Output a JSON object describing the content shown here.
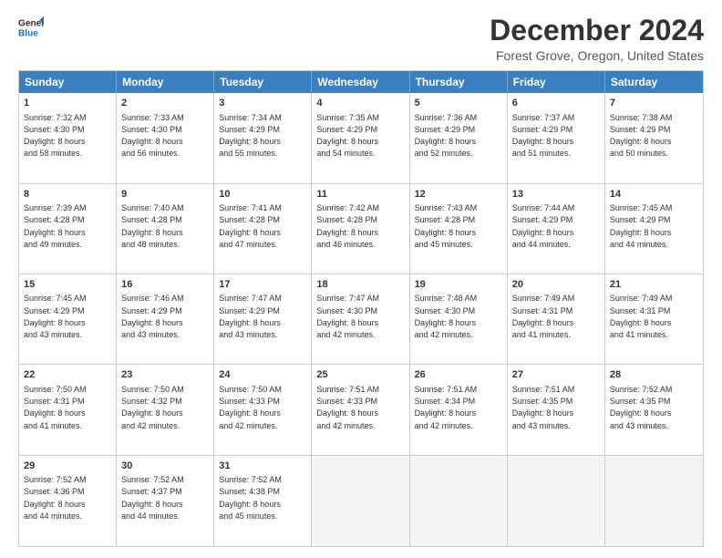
{
  "logo": {
    "line1": "General",
    "line2": "Blue",
    "icon_color": "#1a73c8"
  },
  "title": "December 2024",
  "subtitle": "Forest Grove, Oregon, United States",
  "days": [
    "Sunday",
    "Monday",
    "Tuesday",
    "Wednesday",
    "Thursday",
    "Friday",
    "Saturday"
  ],
  "weeks": [
    [
      {
        "day": "1",
        "sunrise": "7:32 AM",
        "sunset": "4:30 PM",
        "daylight": "8 hours and 58 minutes."
      },
      {
        "day": "2",
        "sunrise": "7:33 AM",
        "sunset": "4:30 PM",
        "daylight": "8 hours and 56 minutes."
      },
      {
        "day": "3",
        "sunrise": "7:34 AM",
        "sunset": "4:29 PM",
        "daylight": "8 hours and 55 minutes."
      },
      {
        "day": "4",
        "sunrise": "7:35 AM",
        "sunset": "4:29 PM",
        "daylight": "8 hours and 54 minutes."
      },
      {
        "day": "5",
        "sunrise": "7:36 AM",
        "sunset": "4:29 PM",
        "daylight": "8 hours and 52 minutes."
      },
      {
        "day": "6",
        "sunrise": "7:37 AM",
        "sunset": "4:29 PM",
        "daylight": "8 hours and 51 minutes."
      },
      {
        "day": "7",
        "sunrise": "7:38 AM",
        "sunset": "4:29 PM",
        "daylight": "8 hours and 50 minutes."
      }
    ],
    [
      {
        "day": "8",
        "sunrise": "7:39 AM",
        "sunset": "4:28 PM",
        "daylight": "8 hours and 49 minutes."
      },
      {
        "day": "9",
        "sunrise": "7:40 AM",
        "sunset": "4:28 PM",
        "daylight": "8 hours and 48 minutes."
      },
      {
        "day": "10",
        "sunrise": "7:41 AM",
        "sunset": "4:28 PM",
        "daylight": "8 hours and 47 minutes."
      },
      {
        "day": "11",
        "sunrise": "7:42 AM",
        "sunset": "4:28 PM",
        "daylight": "8 hours and 46 minutes."
      },
      {
        "day": "12",
        "sunrise": "7:43 AM",
        "sunset": "4:28 PM",
        "daylight": "8 hours and 45 minutes."
      },
      {
        "day": "13",
        "sunrise": "7:44 AM",
        "sunset": "4:29 PM",
        "daylight": "8 hours and 44 minutes."
      },
      {
        "day": "14",
        "sunrise": "7:45 AM",
        "sunset": "4:29 PM",
        "daylight": "8 hours and 44 minutes."
      }
    ],
    [
      {
        "day": "15",
        "sunrise": "7:45 AM",
        "sunset": "4:29 PM",
        "daylight": "8 hours and 43 minutes."
      },
      {
        "day": "16",
        "sunrise": "7:46 AM",
        "sunset": "4:29 PM",
        "daylight": "8 hours and 43 minutes."
      },
      {
        "day": "17",
        "sunrise": "7:47 AM",
        "sunset": "4:29 PM",
        "daylight": "8 hours and 43 minutes."
      },
      {
        "day": "18",
        "sunrise": "7:47 AM",
        "sunset": "4:30 PM",
        "daylight": "8 hours and 42 minutes."
      },
      {
        "day": "19",
        "sunrise": "7:48 AM",
        "sunset": "4:30 PM",
        "daylight": "8 hours and 42 minutes."
      },
      {
        "day": "20",
        "sunrise": "7:49 AM",
        "sunset": "4:31 PM",
        "daylight": "8 hours and 41 minutes."
      },
      {
        "day": "21",
        "sunrise": "7:49 AM",
        "sunset": "4:31 PM",
        "daylight": "8 hours and 41 minutes."
      }
    ],
    [
      {
        "day": "22",
        "sunrise": "7:50 AM",
        "sunset": "4:31 PM",
        "daylight": "8 hours and 41 minutes."
      },
      {
        "day": "23",
        "sunrise": "7:50 AM",
        "sunset": "4:32 PM",
        "daylight": "8 hours and 42 minutes."
      },
      {
        "day": "24",
        "sunrise": "7:50 AM",
        "sunset": "4:33 PM",
        "daylight": "8 hours and 42 minutes."
      },
      {
        "day": "25",
        "sunrise": "7:51 AM",
        "sunset": "4:33 PM",
        "daylight": "8 hours and 42 minutes."
      },
      {
        "day": "26",
        "sunrise": "7:51 AM",
        "sunset": "4:34 PM",
        "daylight": "8 hours and 42 minutes."
      },
      {
        "day": "27",
        "sunrise": "7:51 AM",
        "sunset": "4:35 PM",
        "daylight": "8 hours and 43 minutes."
      },
      {
        "day": "28",
        "sunrise": "7:52 AM",
        "sunset": "4:35 PM",
        "daylight": "8 hours and 43 minutes."
      }
    ],
    [
      {
        "day": "29",
        "sunrise": "7:52 AM",
        "sunset": "4:36 PM",
        "daylight": "8 hours and 44 minutes."
      },
      {
        "day": "30",
        "sunrise": "7:52 AM",
        "sunset": "4:37 PM",
        "daylight": "8 hours and 44 minutes."
      },
      {
        "day": "31",
        "sunrise": "7:52 AM",
        "sunset": "4:38 PM",
        "daylight": "8 hours and 45 minutes."
      },
      null,
      null,
      null,
      null
    ]
  ],
  "labels": {
    "sunrise": "Sunrise:",
    "sunset": "Sunset:",
    "daylight": "Daylight:"
  }
}
